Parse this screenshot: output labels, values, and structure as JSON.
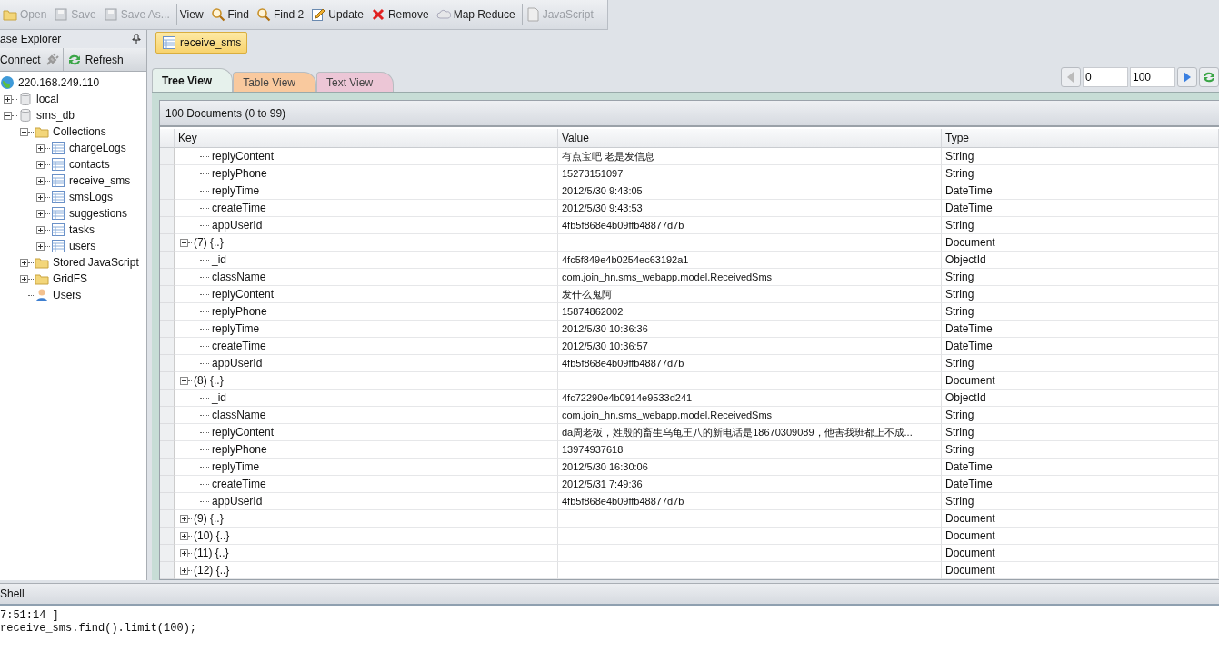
{
  "toolbar": [
    {
      "buttons": [
        {
          "label": "Open",
          "disabled": true
        },
        {
          "label": "Save",
          "disabled": true
        },
        {
          "label": "Save As...",
          "disabled": true
        }
      ]
    },
    {
      "buttons": [
        {
          "label": "View",
          "disabled": false
        },
        {
          "label": "Find",
          "disabled": false
        },
        {
          "label": "Find 2",
          "disabled": false
        },
        {
          "label": "Update",
          "disabled": false
        },
        {
          "label": "Remove",
          "disabled": false
        },
        {
          "label": "Map Reduce",
          "disabled": false
        }
      ]
    },
    {
      "buttons": [
        {
          "label": "JavaScript",
          "disabled": true
        }
      ]
    }
  ],
  "explorer": {
    "title": "ase Explorer",
    "actions": [
      {
        "label": "Connect",
        "disabled": false
      },
      {
        "label": "Refresh",
        "disabled": false
      }
    ],
    "tree": [
      {
        "label": "220.168.249.110",
        "kind": "server",
        "children": [
          {
            "label": "local",
            "kind": "database",
            "expanded": false
          },
          {
            "label": "sms_db",
            "kind": "database",
            "expanded": true,
            "children": [
              {
                "label": "Collections",
                "kind": "folder",
                "expanded": true,
                "children": [
                  {
                    "label": "chargeLogs",
                    "kind": "collection",
                    "expanded": false
                  },
                  {
                    "label": "contacts",
                    "kind": "collection",
                    "expanded": false
                  },
                  {
                    "label": "receive_sms",
                    "kind": "collection",
                    "expanded": false
                  },
                  {
                    "label": "smsLogs",
                    "kind": "collection",
                    "expanded": false
                  },
                  {
                    "label": "suggestions",
                    "kind": "collection",
                    "expanded": false
                  },
                  {
                    "label": "tasks",
                    "kind": "collection",
                    "expanded": false
                  },
                  {
                    "label": "users",
                    "kind": "collection",
                    "expanded": false
                  }
                ]
              },
              {
                "label": "Stored JavaScript",
                "kind": "folder",
                "expanded": false
              },
              {
                "label": "GridFS",
                "kind": "folder",
                "expanded": false
              },
              {
                "label": "Users",
                "kind": "users"
              }
            ]
          }
        ]
      }
    ]
  },
  "document_tab": {
    "label": "receive_sms"
  },
  "view_tabs": [
    {
      "label": "Tree View",
      "selected": true,
      "color": "#e6f1ec"
    },
    {
      "label": "Table View",
      "selected": false,
      "color": "#f9c99e"
    },
    {
      "label": "Text View",
      "selected": false,
      "color": "#ecc6d6"
    }
  ],
  "pager": {
    "skip": "0",
    "limit": "100",
    "prev_disabled": true
  },
  "result": {
    "summary": "100 Documents (0 to 99)",
    "columns": [
      "Key",
      "Value",
      "Type"
    ],
    "documents": [
      {
        "children": [
          {
            "key": "replyContent",
            "value": "有点宝吧 老是发信息",
            "type": "String"
          },
          {
            "key": "replyPhone",
            "value": "15273151097",
            "type": "String"
          },
          {
            "key": "replyTime",
            "value": "2012/5/30 9:43:05",
            "type": "DateTime"
          },
          {
            "key": "createTime",
            "value": "2012/5/30 9:43:53",
            "type": "DateTime"
          },
          {
            "key": "appUserId",
            "value": "4fb5f868e4b09ffb48877d7b",
            "type": "String"
          }
        ]
      },
      {
        "label": "(7) {..}",
        "type": "Document",
        "expanded": true,
        "children": [
          {
            "key": "_id",
            "value": "4fc5f849e4b0254ec63192a1",
            "type": "ObjectId"
          },
          {
            "key": "className",
            "value": "com.join_hn.sms_webapp.model.ReceivedSms",
            "type": "String"
          },
          {
            "key": "replyContent",
            "value": "发什么鬼阿",
            "type": "String"
          },
          {
            "key": "replyPhone",
            "value": "15874862002",
            "type": "String"
          },
          {
            "key": "replyTime",
            "value": "2012/5/30 10:36:36",
            "type": "DateTime"
          },
          {
            "key": "createTime",
            "value": "2012/5/30 10:36:57",
            "type": "DateTime"
          },
          {
            "key": "appUserId",
            "value": "4fb5f868e4b09ffb48877d7b",
            "type": "String"
          }
        ]
      },
      {
        "label": "(8) {..}",
        "type": "Document",
        "expanded": true,
        "children": [
          {
            "key": "_id",
            "value": "4fc72290e4b0914e9533d241",
            "type": "ObjectId"
          },
          {
            "key": "className",
            "value": "com.join_hn.sms_webapp.model.ReceivedSms",
            "type": "String"
          },
          {
            "key": "replyContent",
            "value": "dā周老板，姓殷的畜生乌龟王八的新电话是18670309089，他害我班都上不成...",
            "type": "String"
          },
          {
            "key": "replyPhone",
            "value": "13974937618",
            "type": "String"
          },
          {
            "key": "replyTime",
            "value": "2012/5/30 16:30:06",
            "type": "DateTime"
          },
          {
            "key": "createTime",
            "value": "2012/5/31 7:49:36",
            "type": "DateTime"
          },
          {
            "key": "appUserId",
            "value": "4fb5f868e4b09ffb48877d7b",
            "type": "String"
          }
        ]
      },
      {
        "label": "(9) {..}",
        "type": "Document",
        "expanded": false
      },
      {
        "label": "(10) {..}",
        "type": "Document",
        "expanded": false
      },
      {
        "label": "(11) {..}",
        "type": "Document",
        "expanded": false
      },
      {
        "label": "(12) {..}",
        "type": "Document",
        "expanded": false
      }
    ]
  },
  "shell": {
    "title": "Shell",
    "lines": [
      "7:51:14 ]",
      "receive_sms.find().limit(100);"
    ]
  }
}
